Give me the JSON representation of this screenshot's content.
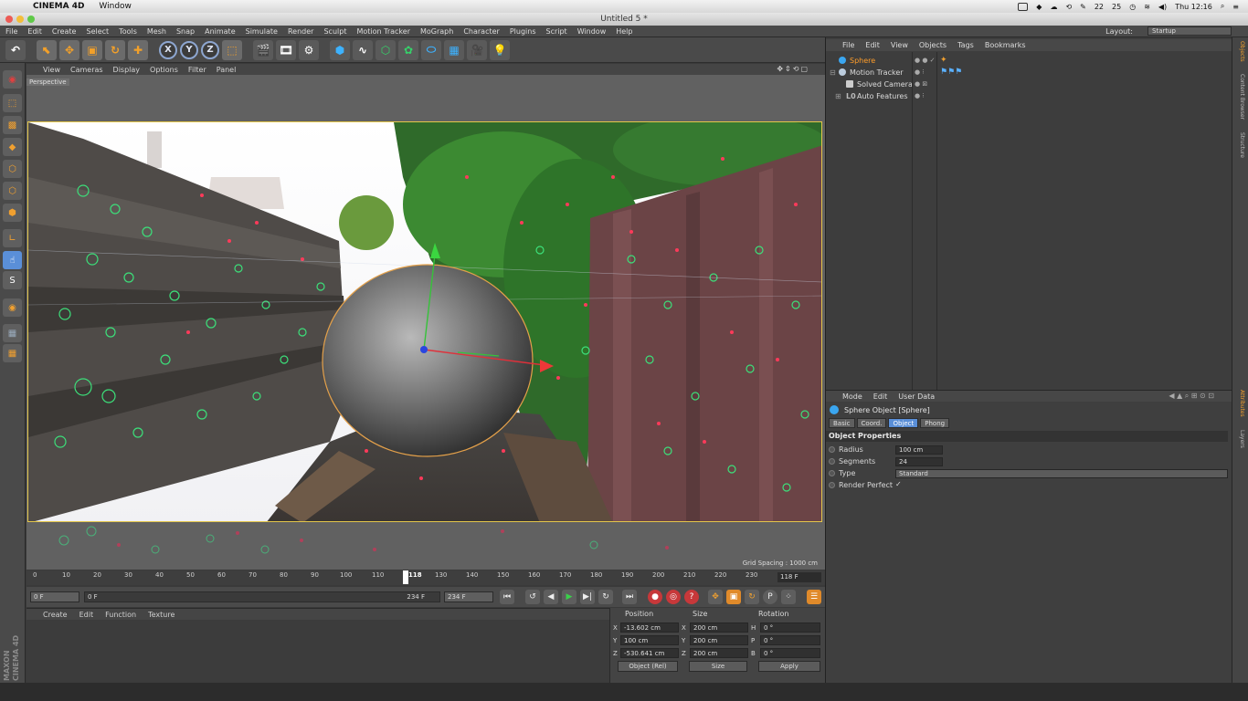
{
  "mac_menubar": {
    "app_name": "CINEMA 4D",
    "menus": [
      "Window"
    ],
    "status_battery": "22",
    "status_cpu": "25",
    "clock": "Thu 12:16"
  },
  "window": {
    "title": "Untitled 5 *"
  },
  "app_menu": {
    "items": [
      "File",
      "Edit",
      "Create",
      "Select",
      "Tools",
      "Mesh",
      "Snap",
      "Animate",
      "Simulate",
      "Render",
      "Sculpt",
      "Motion Tracker",
      "MoGraph",
      "Character",
      "Plugins",
      "Script",
      "Window",
      "Help"
    ],
    "layout_label": "Layout:",
    "layout_value": "Startup"
  },
  "toolbar": {
    "axis_x": "X",
    "axis_y": "Y",
    "axis_z": "Z"
  },
  "viewport": {
    "menu": [
      "View",
      "Cameras",
      "Display",
      "Options",
      "Filter",
      "Panel"
    ],
    "label": "Perspective",
    "grid_spacing": "Grid Spacing : 1000 cm"
  },
  "timeline": {
    "ticks": [
      "0",
      "10",
      "20",
      "30",
      "40",
      "50",
      "60",
      "70",
      "80",
      "90",
      "100",
      "110",
      "118",
      "130",
      "140",
      "150",
      "160",
      "170",
      "180",
      "190",
      "200",
      "210",
      "220",
      "230"
    ],
    "current_frame": "118 F"
  },
  "transport": {
    "start_field": "0 F",
    "range_start": "0 F",
    "range_end": "234 F",
    "end_field": "234 F"
  },
  "material_manager": {
    "menu": [
      "Create",
      "Edit",
      "Function",
      "Texture"
    ],
    "brand": "MAXON CINEMA 4D"
  },
  "coord_manager": {
    "headers": {
      "position": "Position",
      "size": "Size",
      "rotation": "Rotation"
    },
    "rows": [
      {
        "axis": "X",
        "pos": "-13.602 cm",
        "size_axis": "X",
        "size": "200 cm",
        "rot_axis": "H",
        "rot": "0 °"
      },
      {
        "axis": "Y",
        "pos": "100 cm",
        "size_axis": "Y",
        "size": "200 cm",
        "rot_axis": "P",
        "rot": "0 °"
      },
      {
        "axis": "Z",
        "pos": "-530.641 cm",
        "size_axis": "Z",
        "size": "200 cm",
        "rot_axis": "B",
        "rot": "0 °"
      }
    ],
    "mode_dropdown": "Object (Rel)",
    "size_dropdown": "Size",
    "apply": "Apply"
  },
  "object_manager": {
    "menu": [
      "File",
      "Edit",
      "View",
      "Objects",
      "Tags",
      "Bookmarks"
    ],
    "objects": [
      {
        "name": "Sphere",
        "selected": true,
        "color": "#ff9d2a"
      },
      {
        "name": "Motion Tracker",
        "selected": false,
        "color": "#dcdcdc"
      },
      {
        "name": "Solved Camera",
        "selected": false,
        "color": "#dcdcdc"
      },
      {
        "name": "Auto Features",
        "selected": false,
        "color": "#dcdcdc"
      }
    ]
  },
  "attribute_manager": {
    "menu": [
      "Mode",
      "Edit",
      "User Data"
    ],
    "title": "Sphere Object [Sphere]",
    "tabs": [
      {
        "label": "Basic",
        "active": false
      },
      {
        "label": "Coord.",
        "active": false
      },
      {
        "label": "Object",
        "active": true
      },
      {
        "label": "Phong",
        "active": false
      }
    ],
    "section": "Object Properties",
    "properties": [
      {
        "label": "Radius",
        "value": "100 cm"
      },
      {
        "label": "Segments",
        "value": "24"
      },
      {
        "label": "Type",
        "value": "Standard"
      },
      {
        "label": "Render Perfect",
        "value": "✓"
      }
    ]
  },
  "side_tabs": [
    "Objects",
    "Content Browser",
    "Structure",
    "Attributes",
    "Layers"
  ]
}
